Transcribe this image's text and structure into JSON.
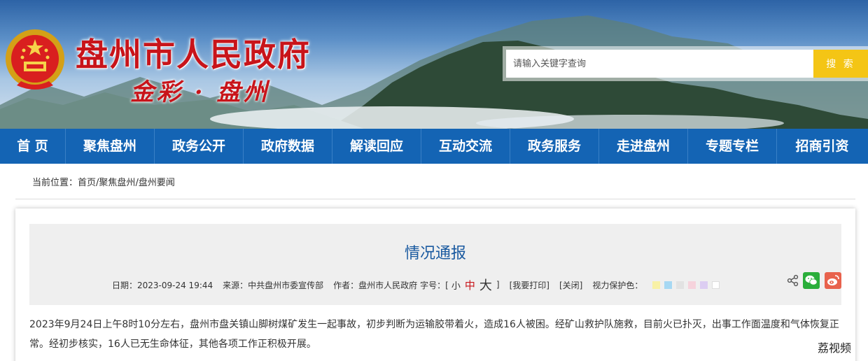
{
  "header": {
    "title": "盘州市人民政府",
    "slogan": "金彩 · 盘州"
  },
  "search": {
    "placeholder": "请输入关键字查询",
    "button_label": "搜 索"
  },
  "nav": {
    "items": [
      "首 页",
      "聚焦盘州",
      "政务公开",
      "政府数据",
      "解读回应",
      "互动交流",
      "政务服务",
      "走进盘州",
      "专题专栏",
      "招商引资"
    ]
  },
  "breadcrumb": {
    "prefix": "当前位置：",
    "items": [
      "首页",
      "聚焦盘州",
      "盘州要闻"
    ]
  },
  "article": {
    "title": "情况通报",
    "date": "日期：2023-09-24 19:44",
    "source": "来源：中共盘州市委宣传部",
    "author": "作者：盘州市人民政府",
    "font_size_label": "字号：[",
    "font_small": "小",
    "font_mid": "中",
    "font_big": "大",
    "font_close": "]",
    "print": "[我要打印]",
    "close": "[关闭]",
    "eye_care": "视力保护色：",
    "eye_colors": [
      "#f8f1a6",
      "#a6d8f3",
      "#e2e2e2",
      "#f6d3dc",
      "#dccdf2",
      "#ffffff"
    ],
    "body": "2023年9月24日上午8时10分左右，盘州市盘关镇山脚树煤矿发生一起事故，初步判断为运输胶带着火，造成16人被困。经矿山救护队施救，目前火已扑灭，出事工作面温度和气体恢复正常。经初步核实，16人已无生命体征，其他各项工作正积极开展。"
  },
  "watermark": "荔视频",
  "colors": {
    "nav_bg": "#1464b4",
    "title_red": "#c8141a",
    "search_btn": "#f4c515",
    "article_title": "#1a5aa0"
  },
  "icons": [
    "national-emblem-icon",
    "share-icon",
    "wechat-icon",
    "weibo-icon"
  ]
}
